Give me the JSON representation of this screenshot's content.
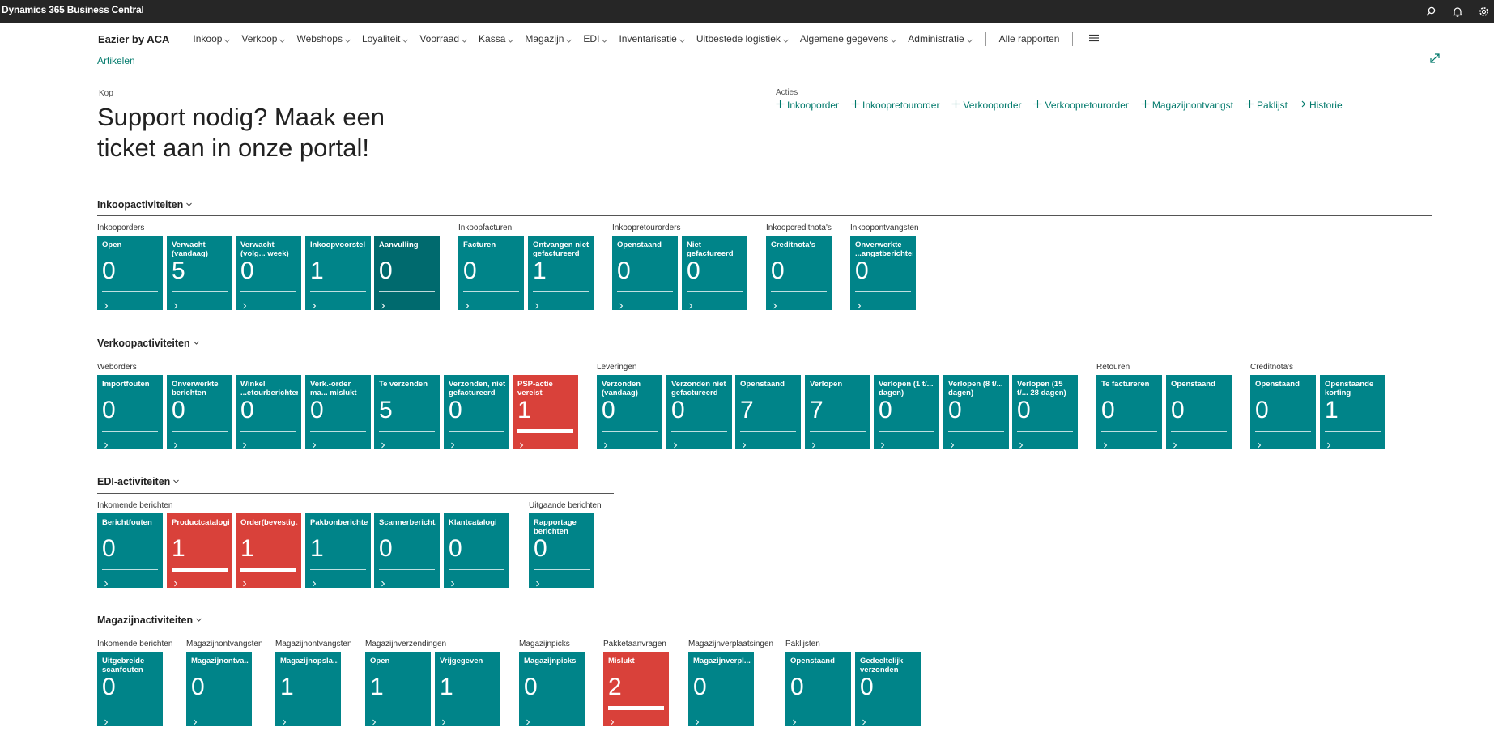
{
  "app": {
    "title": "Dynamics 365 Business Central"
  },
  "nav": {
    "company": "Eazier by ACA",
    "items": [
      "Inkoop",
      "Verkoop",
      "Webshops",
      "Loyaliteit",
      "Voorraad",
      "Kassa",
      "Magazijn",
      "EDI",
      "Inventarisatie",
      "Uitbestede logistiek",
      "Algemene gegevens",
      "Administratie"
    ],
    "all_reports": "Alle rapporten"
  },
  "breadcrumb": "Artikelen",
  "headline": {
    "label": "Kop",
    "text": "Support nodig? Maak een ticket aan in onze portal!"
  },
  "actions": {
    "label": "Acties",
    "items": [
      {
        "icon": "plus-icon",
        "label": "Inkooporder"
      },
      {
        "icon": "plus-icon",
        "label": "Inkoopretourorder"
      },
      {
        "icon": "plus-icon",
        "label": "Verkooporder"
      },
      {
        "icon": "plus-icon",
        "label": "Verkoopretourorder"
      },
      {
        "icon": "plus-icon",
        "label": "Magazijnontvangst"
      },
      {
        "icon": "plus-icon",
        "label": "Paklijst"
      },
      {
        "icon": "chevron-right-icon",
        "label": "Historie"
      }
    ]
  },
  "colors": {
    "tile": "#008489",
    "tile_dark": "#006a6e",
    "tile_alert": "#d9413a",
    "accent": "#00796b",
    "topbar": "#262626"
  },
  "sections": [
    {
      "title": "Inkoopactiviteiten",
      "groups": [
        {
          "label": "Inkooporders",
          "tiles": [
            {
              "name": "Open",
              "value": "0"
            },
            {
              "name": "Verwacht (vandaag)",
              "value": "5"
            },
            {
              "name": "Verwacht (volg... week)",
              "value": "0"
            },
            {
              "name": "Inkoopvoorstel",
              "value": "1"
            },
            {
              "name": "Aanvulling",
              "value": "0",
              "style": "dark"
            }
          ]
        },
        {
          "label": "Inkoopfacturen",
          "tiles": [
            {
              "name": "Facturen",
              "value": "0"
            },
            {
              "name": "Ontvangen niet gefactureerd",
              "value": "1"
            }
          ]
        },
        {
          "label": "Inkoopretourorders",
          "tiles": [
            {
              "name": "Openstaand",
              "value": "0"
            },
            {
              "name": "Niet gefactureerd",
              "value": "0"
            }
          ]
        },
        {
          "label": "Inkoopcreditnota's",
          "tiles": [
            {
              "name": "Creditnota's",
              "value": "0"
            }
          ]
        },
        {
          "label": "Inkoopontvangsten",
          "tiles": [
            {
              "name": "Onverwerkte ...angstberichten",
              "value": "0"
            }
          ]
        }
      ]
    },
    {
      "title": "Verkoopactiviteiten",
      "groups": [
        {
          "label": "Weborders",
          "tiles": [
            {
              "name": "Importfouten",
              "value": "0"
            },
            {
              "name": "Onverwerkte berichten",
              "value": "0"
            },
            {
              "name": "Winkel ...etourberichten",
              "value": "0"
            },
            {
              "name": "Verk.-order ma... mislukt",
              "value": "0"
            },
            {
              "name": "Te verzenden",
              "value": "5"
            },
            {
              "name": "Verzonden, niet gefactureerd",
              "value": "0"
            },
            {
              "name": "PSP-actie vereist",
              "value": "1",
              "style": "red"
            }
          ]
        },
        {
          "label": "Leveringen",
          "tiles": [
            {
              "name": "Verzonden (vandaag)",
              "value": "0"
            },
            {
              "name": "Verzonden niet gefactureerd",
              "value": "0"
            },
            {
              "name": "Openstaand",
              "value": "7"
            },
            {
              "name": "Verlopen",
              "value": "7"
            },
            {
              "name": "Verlopen (1 t/... dagen)",
              "value": "0"
            },
            {
              "name": "Verlopen (8 t/... dagen)",
              "value": "0"
            },
            {
              "name": "Verlopen (15 t/... 28 dagen)",
              "value": "0"
            }
          ]
        },
        {
          "label": "Retouren",
          "tiles": [
            {
              "name": "Te factureren",
              "value": "0"
            },
            {
              "name": "Openstaand",
              "value": "0"
            }
          ]
        },
        {
          "label": "Creditnota's",
          "tiles": [
            {
              "name": "Openstaand",
              "value": "0"
            },
            {
              "name": "Openstaande korting",
              "value": "1"
            }
          ]
        }
      ]
    },
    {
      "title": "EDI-activiteiten",
      "groups": [
        {
          "label": "Inkomende berichten",
          "tiles": [
            {
              "name": "Berichtfouten",
              "value": "0"
            },
            {
              "name": "Productcatalogi",
              "value": "1",
              "style": "red"
            },
            {
              "name": "Order(bevestig...",
              "value": "1",
              "style": "red"
            },
            {
              "name": "Pakbonberichten",
              "value": "1"
            },
            {
              "name": "Scannerbericht...",
              "value": "0"
            },
            {
              "name": "Klantcatalogi",
              "value": "0"
            }
          ]
        },
        {
          "label": "Uitgaande berichten",
          "tiles": [
            {
              "name": "Rapportage berichten",
              "value": "0"
            }
          ]
        }
      ]
    },
    {
      "title": "Magazijnactiviteiten",
      "groups": [
        {
          "label": "Inkomende berichten",
          "tiles": [
            {
              "name": "Uitgebreide scanfouten",
              "value": "0"
            }
          ]
        },
        {
          "label": "Magazijnontvangsten",
          "tiles": [
            {
              "name": "Magazijnontva...",
              "value": "0"
            }
          ]
        },
        {
          "label": "Magazijnontvangsten",
          "tiles": [
            {
              "name": "Magazijnopsla...",
              "value": "1"
            }
          ]
        },
        {
          "label": "Magazijnverzendingen",
          "tiles": [
            {
              "name": "Open",
              "value": "1"
            },
            {
              "name": "Vrijgegeven",
              "value": "1"
            }
          ]
        },
        {
          "label": "Magazijnpicks",
          "tiles": [
            {
              "name": "Magazijnpicks",
              "value": "0"
            }
          ]
        },
        {
          "label": "Pakketaanvragen",
          "tiles": [
            {
              "name": "Mislukt",
              "value": "2",
              "style": "red"
            }
          ]
        },
        {
          "label": "Magazijnverplaatsingen",
          "tiles": [
            {
              "name": "Magazijnverpl...",
              "value": "0"
            }
          ]
        },
        {
          "label": "Paklijsten",
          "tiles": [
            {
              "name": "Openstaand",
              "value": "0"
            },
            {
              "name": "Gedeeltelijk verzonden",
              "value": "0"
            }
          ]
        }
      ]
    }
  ]
}
